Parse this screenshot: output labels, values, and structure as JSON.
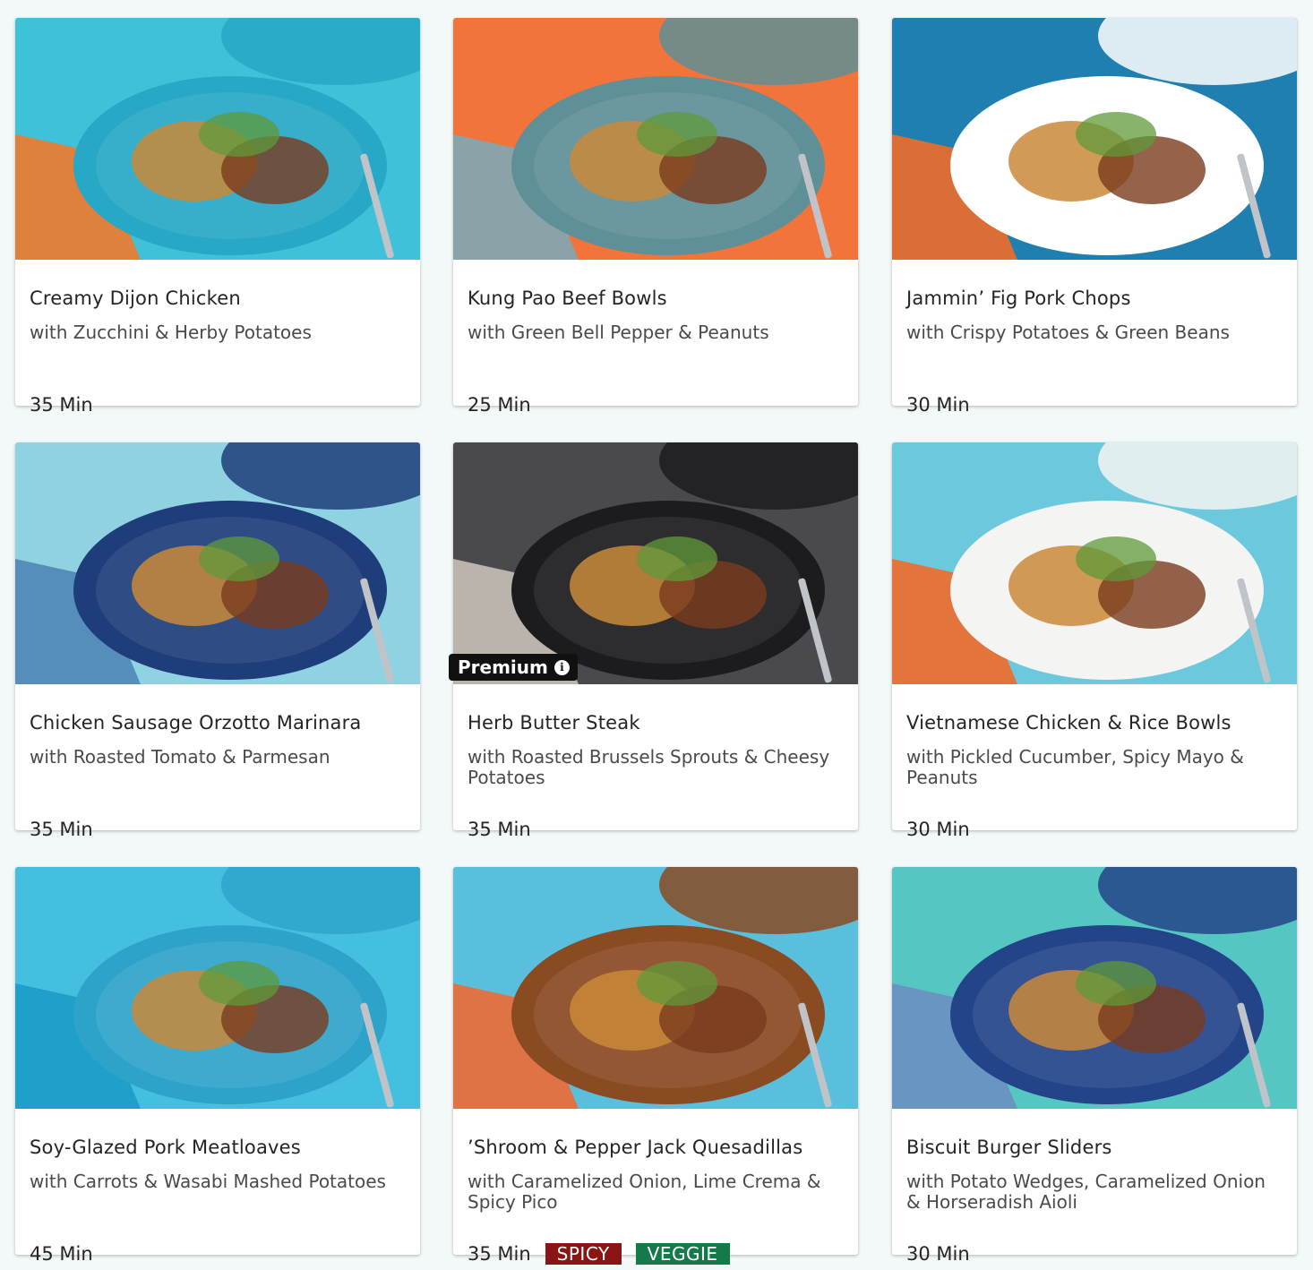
{
  "colors": {
    "spicy": "#8b1515",
    "veggie": "#157a4a",
    "premium": "#111111"
  },
  "recipes": [
    {
      "title": "Creamy Dijon Chicken",
      "subtitle": "with Zucchini & Herby Potatoes",
      "time": "35 Min",
      "bg": "#3ec1d9",
      "plate": "#27a8c6",
      "accent": "#f07a2a"
    },
    {
      "title": "Kung Pao Beef Bowls",
      "subtitle": "with Green Bell Pepper & Peanuts",
      "time": "25 Min",
      "bg": "#f3743a",
      "plate": "#5f8f97",
      "accent": "#7fa7b6"
    },
    {
      "title": "Jammin’ Fig Pork Chops",
      "subtitle": "with Crispy Potatoes & Green Beans",
      "time": "30 Min",
      "bg": "#1e7fb0",
      "plate": "#ffffff",
      "accent": "#f06b2a"
    },
    {
      "title": "Chicken Sausage Orzotto Marinara",
      "subtitle": "with Roasted Tomato & Parmesan",
      "time": "35 Min",
      "bg": "#8fd3e3",
      "plate": "#1f3d7a",
      "accent": "#4f86b5"
    },
    {
      "title": "Herb Butter Steak",
      "subtitle": "with Roasted Brussels Sprouts & Cheesy Potatoes",
      "time": "35 Min",
      "bg": "#4a4a4e",
      "plate": "#1c1c1e",
      "accent": "#c8c0b8",
      "premium": "Premium",
      "info_icon": "i"
    },
    {
      "title": "Vietnamese Chicken & Rice Bowls",
      "subtitle": "with Pickled Cucumber, Spicy Mayo & Peanuts",
      "time": "30 Min",
      "bg": "#6cc8dc",
      "plate": "#f4f4f2",
      "accent": "#ef6a2a"
    },
    {
      "title": "Soy-Glazed Pork Meatloaves",
      "subtitle": "with Carrots & Wasabi Mashed Potatoes",
      "time": "45 Min",
      "bg": "#45bfe0",
      "plate": "#2ea3c9",
      "accent": "#1a9cc8"
    },
    {
      "title": "’Shroom & Pepper Jack Quesadillas",
      "subtitle": "with Caramelized Onion, Lime Crema & Spicy Pico",
      "time": "35 Min",
      "bg": "#59bfdc",
      "plate": "#8a4a22",
      "accent": "#ee6a34",
      "tags": [
        "SPICY",
        "VEGGIE"
      ]
    },
    {
      "title": "Biscuit Burger Sliders",
      "subtitle": "with Potato Wedges, Caramelized Onion & Horseradish Aioli",
      "time": "30 Min",
      "bg": "#56c6c2",
      "plate": "#24448a",
      "accent": "#6a8fc2"
    }
  ]
}
